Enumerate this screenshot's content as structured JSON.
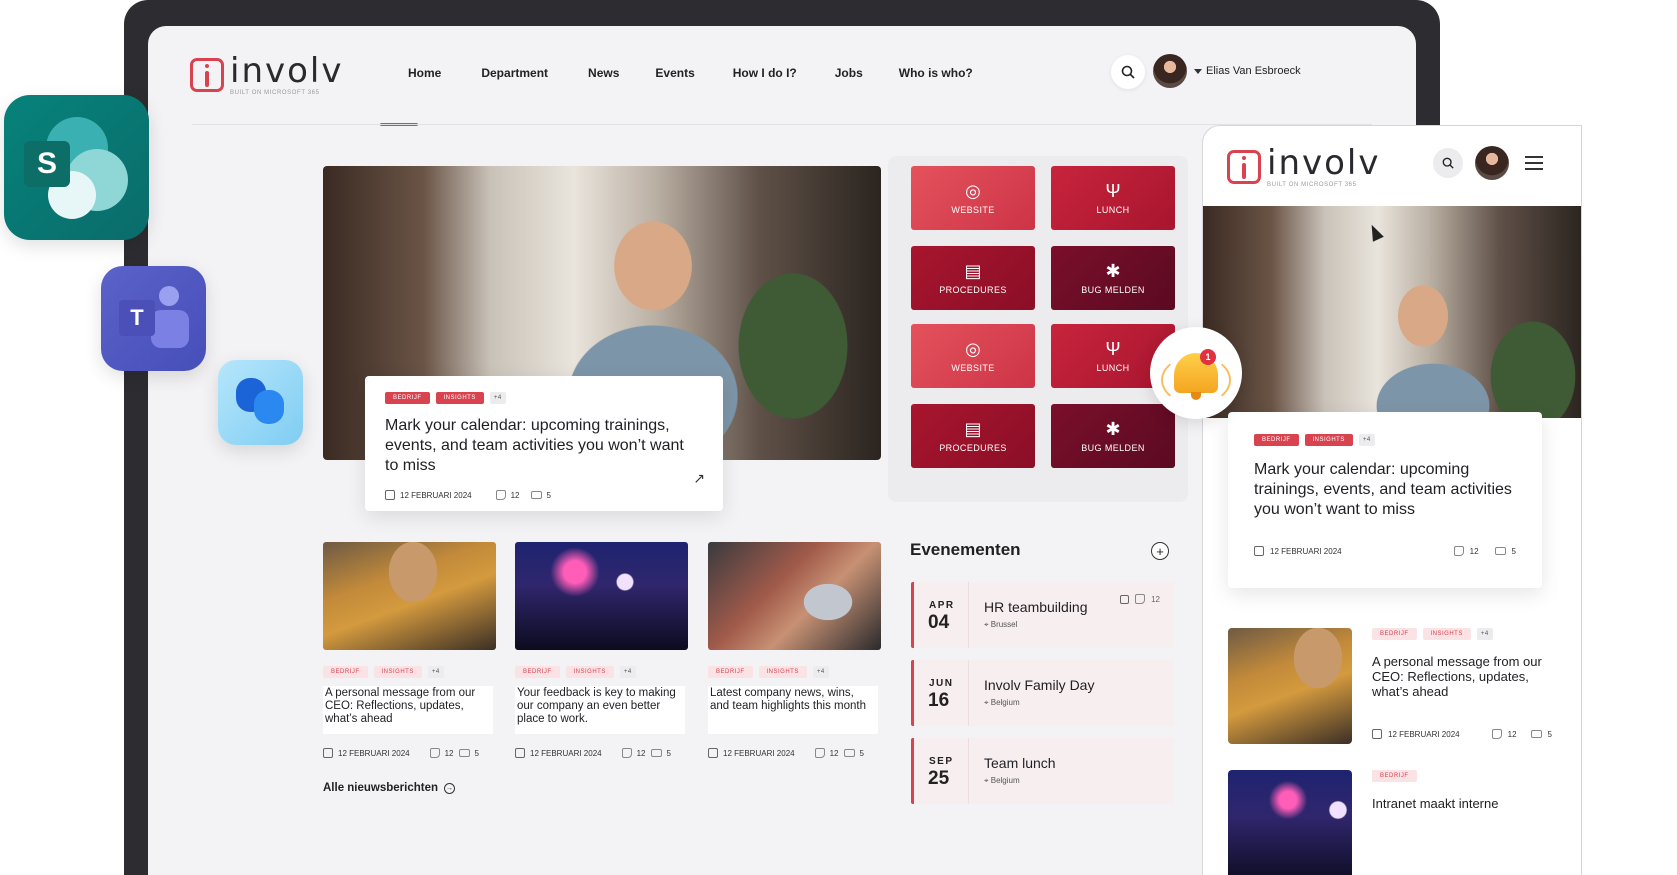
{
  "brand": {
    "name": "involv",
    "tagline": "BUILT ON MICROSOFT 365"
  },
  "nav": {
    "items": [
      "Home",
      "Department",
      "News",
      "Events",
      "How I do I?",
      "Jobs",
      "Who is who?"
    ]
  },
  "user": {
    "name": "Elias Van Esbroeck"
  },
  "hero": {
    "tags": [
      "BEDRIJF",
      "INSIGHTS",
      "+4"
    ],
    "title": "Mark your calendar: upcoming trainings, events, and team activities you won’t want to miss",
    "date": "12 FEBRUARI 2024",
    "likes": "12",
    "comments": "5"
  },
  "tiles": [
    {
      "label": "WEBSITE",
      "icon": "globe-icon"
    },
    {
      "label": "LUNCH",
      "icon": "cutlery-icon"
    },
    {
      "label": "PROCEDURES",
      "icon": "document-icon"
    },
    {
      "label": "BUG MELDEN",
      "icon": "bug-icon"
    },
    {
      "label": "WEBSITE",
      "icon": "globe-icon"
    },
    {
      "label": "LUNCH",
      "icon": "cutlery-icon"
    },
    {
      "label": "PROCEDURES",
      "icon": "document-icon"
    },
    {
      "label": "BUG MELDEN",
      "icon": "bug-icon"
    }
  ],
  "notifications": {
    "count": "1"
  },
  "news": [
    {
      "tags": [
        "BEDRIJF",
        "INSIGHTS",
        "+4"
      ],
      "title": "A personal message from our CEO: Reflections, updates, what’s ahead",
      "date": "12 FEBRUARI 2024",
      "likes": "12",
      "comments": "5"
    },
    {
      "tags": [
        "BEDRIJF",
        "INSIGHTS",
        "+4"
      ],
      "title": "Your feedback is key to making our company an even better place to work.",
      "date": "12 FEBRUARI 2024",
      "likes": "12",
      "comments": "5"
    },
    {
      "tags": [
        "BEDRIJF",
        "INSIGHTS",
        "+4"
      ],
      "title": "Latest company news, wins, and team highlights this month",
      "date": "12 FEBRUARI 2024",
      "likes": "12",
      "comments": "5"
    }
  ],
  "all_news_label": "Alle nieuwsberichten",
  "events": {
    "title": "Evenementen",
    "items": [
      {
        "month": "APR",
        "day": "04",
        "name": "HR teambuilding",
        "location": "Brussel",
        "likes": "12"
      },
      {
        "month": "JUN",
        "day": "16",
        "name": "Involv Family Day",
        "location": "Belgium"
      },
      {
        "month": "SEP",
        "day": "25",
        "name": "Team lunch",
        "location": "Belgium"
      }
    ]
  },
  "mobile": {
    "hero": {
      "tags": [
        "BEDRIJF",
        "INSIGHTS",
        "+4"
      ],
      "title": "Mark your calendar: upcoming trainings, events, and team activities you won’t want to miss",
      "date": "12 FEBRUARI 2024",
      "likes": "12",
      "comments": "5"
    },
    "news": [
      {
        "tags": [
          "BEDRIJF",
          "INSIGHTS",
          "+4"
        ],
        "title": "A personal message from our CEO: Reflections, updates, what’s ahead",
        "date": "12 FEBRUARI 2024",
        "likes": "12",
        "comments": "5"
      },
      {
        "tags": [
          "BEDRIJF"
        ],
        "title": "Intranet maakt interne"
      }
    ]
  },
  "apps": {
    "sharepoint_letter": "S",
    "teams_letter": "T"
  },
  "colors": {
    "accent": "#d8434f",
    "tile_light": "#e4525c",
    "tile_mid": "#c8243d",
    "tile_dark": "#a8152e",
    "tile_darkest": "#7a0f2a"
  }
}
